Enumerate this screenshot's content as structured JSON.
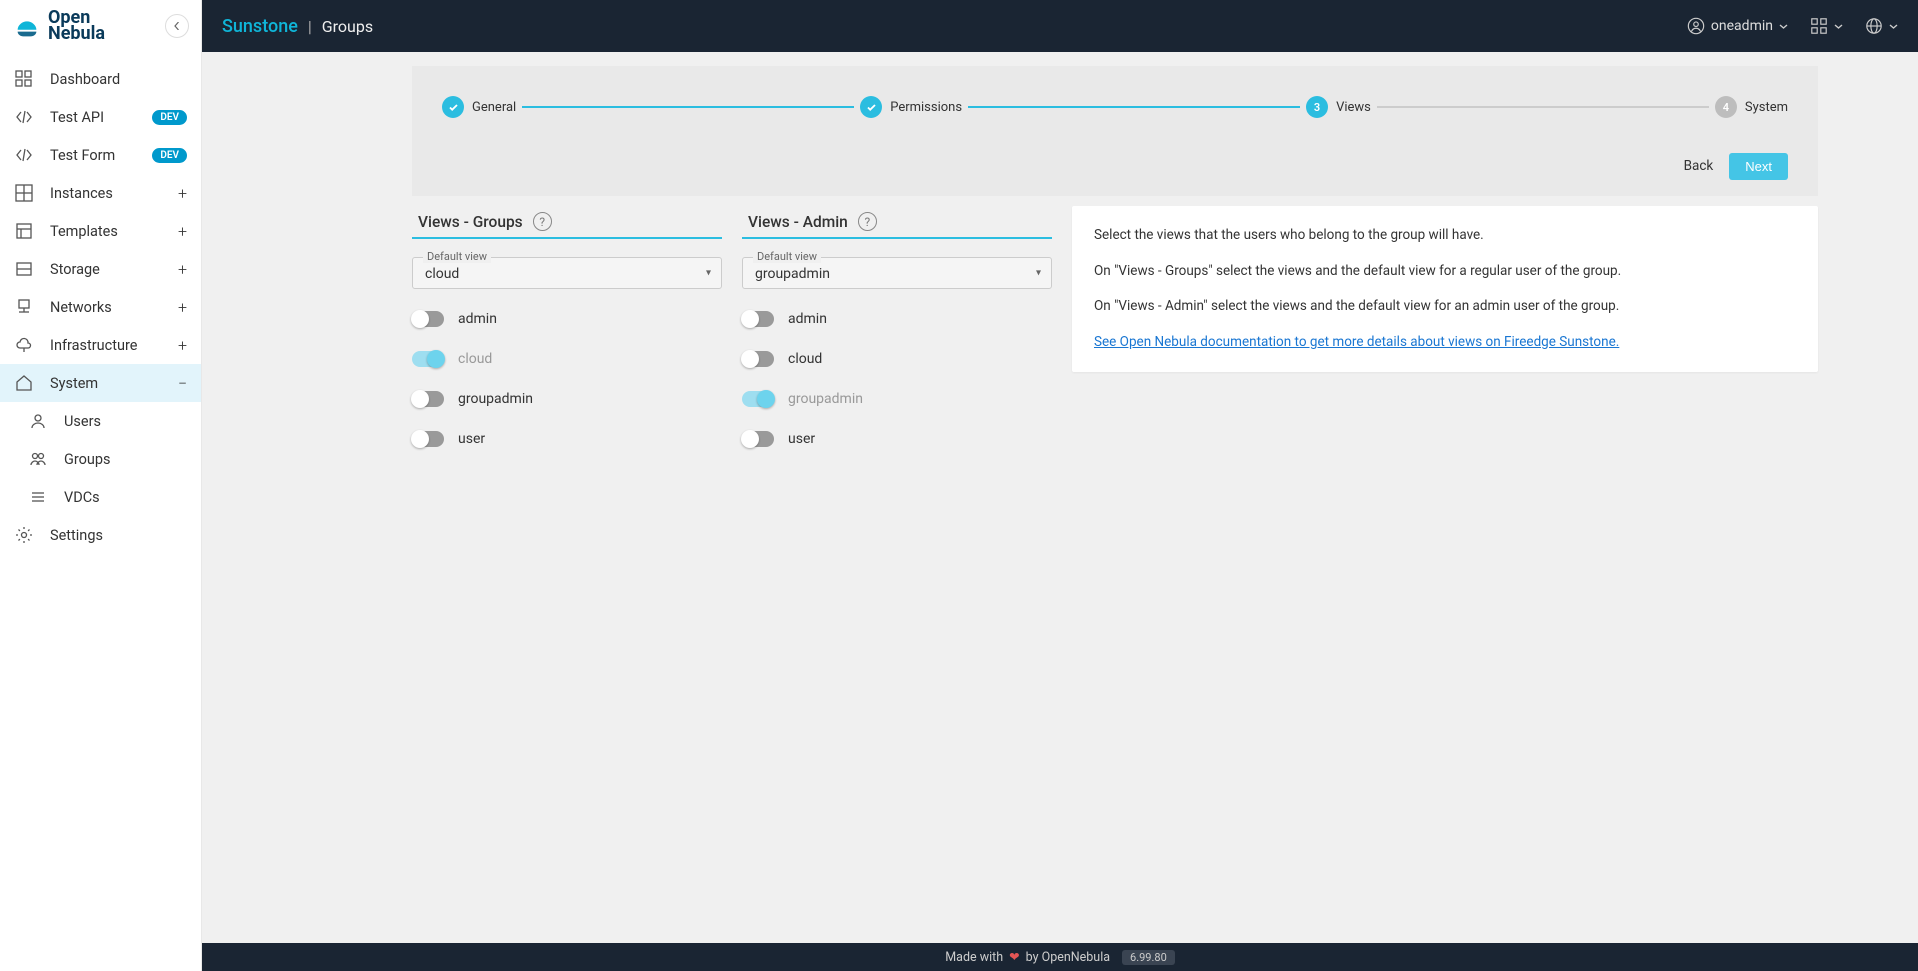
{
  "logo": {
    "top": "Open",
    "bottom": "Nebula"
  },
  "sidebar": {
    "items": [
      {
        "icon": "dashboard",
        "label": "Dashboard",
        "expand": null
      },
      {
        "icon": "code",
        "label": "Test API",
        "badge": "DEV"
      },
      {
        "icon": "code",
        "label": "Test Form",
        "badge": "DEV"
      },
      {
        "icon": "grid",
        "label": "Instances",
        "expand": "plus"
      },
      {
        "icon": "templates",
        "label": "Templates",
        "expand": "plus"
      },
      {
        "icon": "storage",
        "label": "Storage",
        "expand": "plus"
      },
      {
        "icon": "network",
        "label": "Networks",
        "expand": "plus"
      },
      {
        "icon": "infra",
        "label": "Infrastructure",
        "expand": "plus"
      },
      {
        "icon": "system",
        "label": "System",
        "expand": "minus",
        "active": true
      },
      {
        "icon": "user",
        "label": "Users",
        "sub": true
      },
      {
        "icon": "users",
        "label": "Groups",
        "sub": true
      },
      {
        "icon": "list",
        "label": "VDCs",
        "sub": true
      },
      {
        "icon": "gear",
        "label": "Settings"
      }
    ]
  },
  "topbar": {
    "app": "Sunstone",
    "page": "Groups",
    "user": "oneadmin"
  },
  "stepper": {
    "steps": [
      {
        "label": "General",
        "state": "done"
      },
      {
        "label": "Permissions",
        "state": "done"
      },
      {
        "label": "Views",
        "state": "active",
        "num": "3"
      },
      {
        "label": "System",
        "state": "todo",
        "num": "4"
      }
    ],
    "back": "Back",
    "next": "Next"
  },
  "views_groups": {
    "title": "Views - Groups",
    "default_label": "Default view",
    "default_value": "cloud",
    "options": [
      {
        "label": "admin",
        "on": false
      },
      {
        "label": "cloud",
        "on": true,
        "muted": true
      },
      {
        "label": "groupadmin",
        "on": false
      },
      {
        "label": "user",
        "on": false
      }
    ]
  },
  "views_admin": {
    "title": "Views - Admin",
    "default_label": "Default view",
    "default_value": "groupadmin",
    "options": [
      {
        "label": "admin",
        "on": false
      },
      {
        "label": "cloud",
        "on": false
      },
      {
        "label": "groupadmin",
        "on": true,
        "muted": true
      },
      {
        "label": "user",
        "on": false
      }
    ]
  },
  "info": {
    "p1": "Select the views that the users who belong to the group will have.",
    "p2": "On \"Views - Groups\" select the views and the default view for a regular user of the group.",
    "p3": "On \"Views - Admin\" select the views and the default view for an admin user of the group.",
    "link": "See Open Nebula documentation to get more details about views on Fireedge Sunstone."
  },
  "footer": {
    "made": "Made with",
    "by": "by OpenNebula",
    "version": "6.99.80"
  }
}
